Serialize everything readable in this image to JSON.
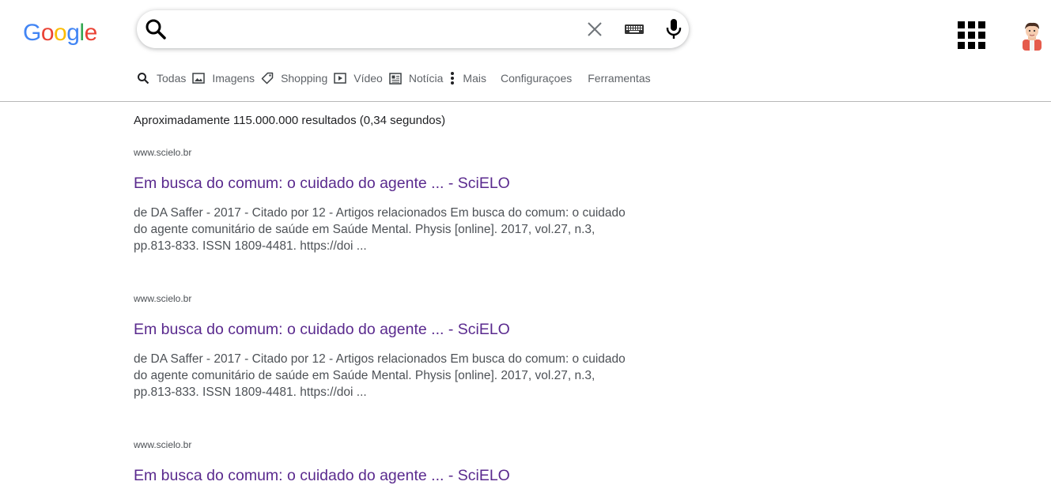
{
  "logo": {
    "letters": [
      "G",
      "o",
      "o",
      "g",
      "l",
      "e"
    ],
    "colors": [
      "#4285f4",
      "#ea4335",
      "#fbbc05",
      "#4285f4",
      "#34a853",
      "#ea4335"
    ]
  },
  "search": {
    "value": "",
    "placeholder": ""
  },
  "tabs": [
    {
      "label": "Todas",
      "icon": "search-icon"
    },
    {
      "label": "Imagens",
      "icon": "image-icon"
    },
    {
      "label": "Shopping",
      "icon": "tag-icon"
    },
    {
      "label": "Vídeo",
      "icon": "video-icon"
    },
    {
      "label": "Notícia",
      "icon": "news-icon"
    },
    {
      "label": "Mais",
      "icon": "more-vert-icon"
    }
  ],
  "tools": {
    "settings": "Configuraçoes",
    "tools": "Ferramentas"
  },
  "stats": "Aproximadamente 115.000.000 resultados (0,34 segundos)",
  "results": [
    {
      "site": "www.scielo.br",
      "title": "Em busca do comum: o cuidado do agente ... - SciELO",
      "snippet": "de DA Saffer - 2017 - Citado por 12 - Artigos relacionados Em busca do comum: o cuidado do agente comunitário de saúde em Saúde Mental. Physis [online]. 2017, vol.27, n.3, pp.813-833. ISSN 1809-4481. https://doi ..."
    },
    {
      "site": "www.scielo.br",
      "title": "Em busca do comum: o cuidado do agente ... - SciELO",
      "snippet": "de DA Saffer - 2017 - Citado por 12 - Artigos relacionados Em busca do comum: o cuidado do agente comunitário de saúde em Saúde Mental. Physis [online]. 2017, vol.27, n.3, pp.813-833. ISSN 1809-4481. https://doi ..."
    },
    {
      "site": "www.scielo.br",
      "title": "Em busca do comum: o cuidado do agente ... - SciELO"
    }
  ],
  "colors": {
    "link_visited": "#5a2a8e",
    "muted": "#5f6368"
  }
}
